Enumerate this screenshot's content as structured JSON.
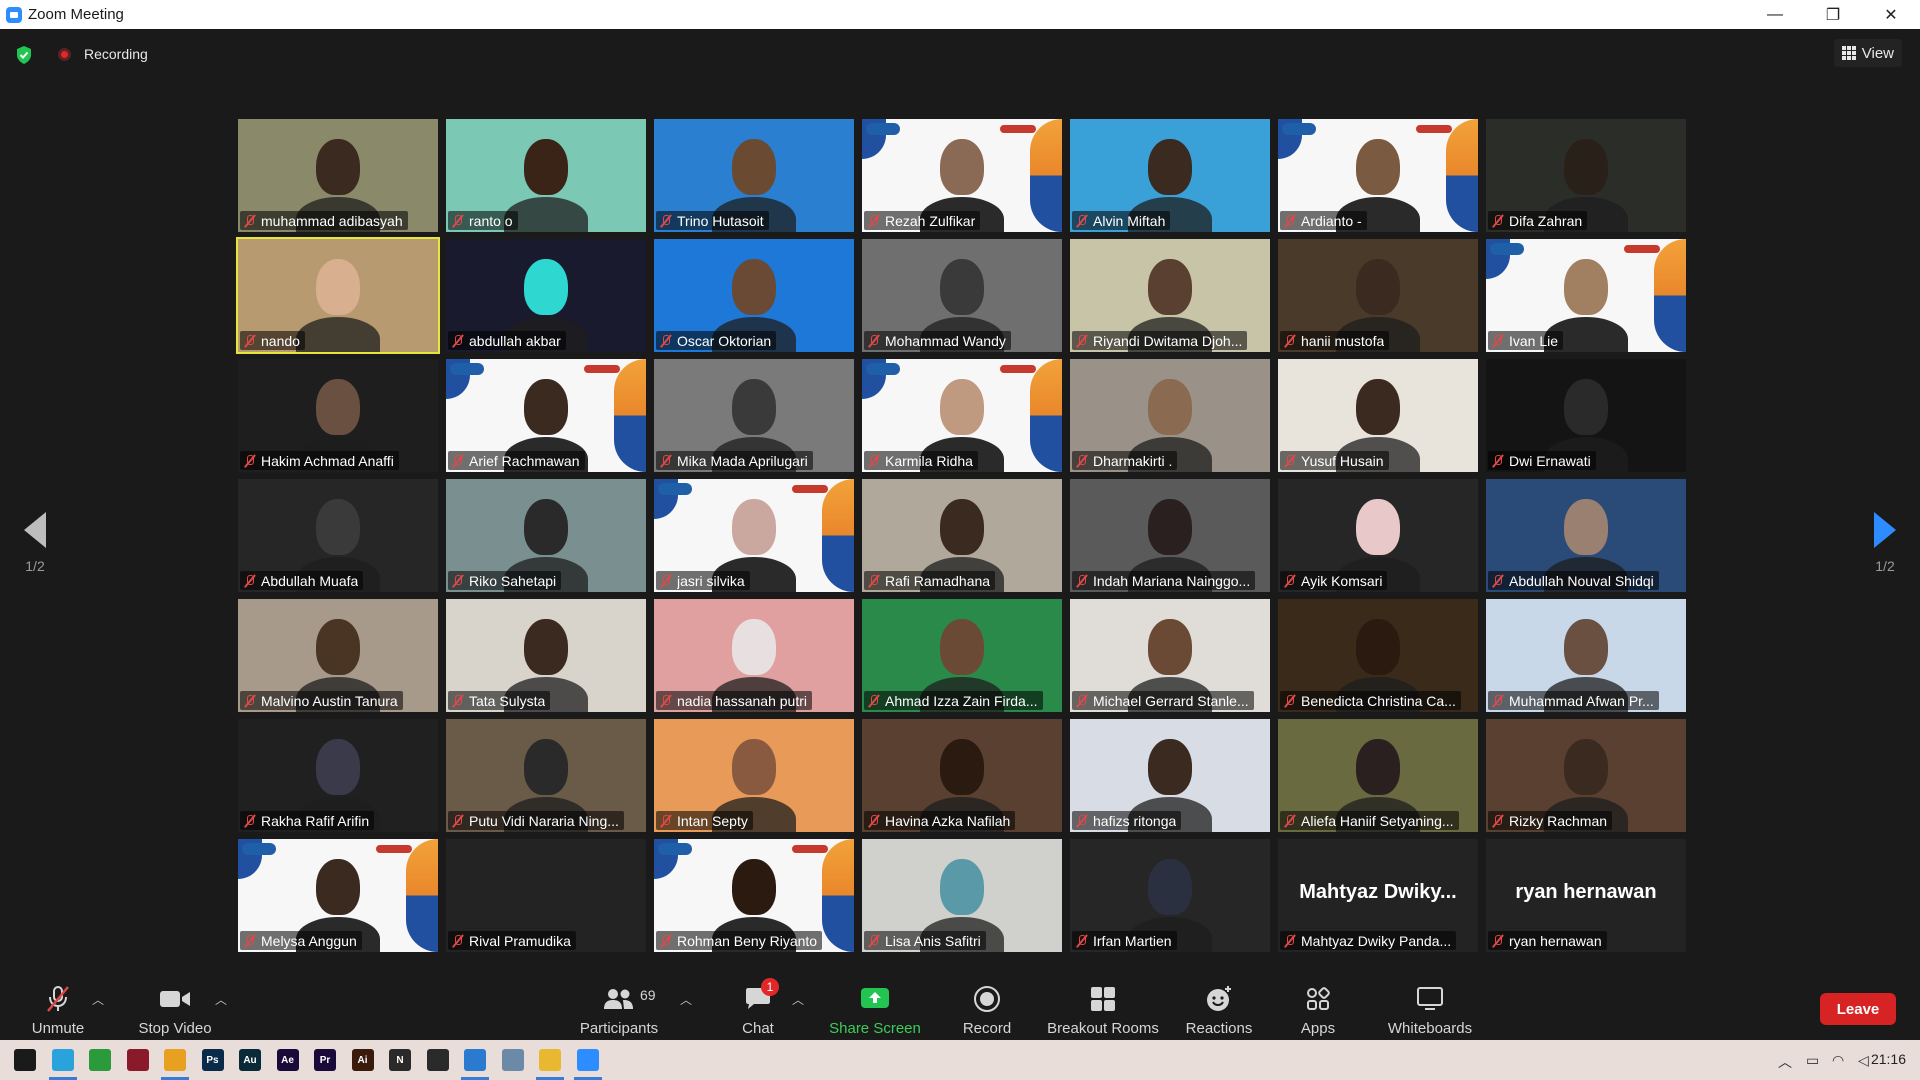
{
  "window": {
    "title": "Zoom Meeting",
    "controls": [
      "—",
      "❐",
      "✕"
    ]
  },
  "meeting_top": {
    "recording_label": "Recording",
    "view_label": "View"
  },
  "pagination": {
    "left_page": "1/2",
    "right_page": "1/2"
  },
  "participants": [
    {
      "name": "muhammad adibasyah",
      "bg": "#8a8a6a",
      "skin": "#3a2a20"
    },
    {
      "name": "ranto o",
      "bg": "#7bc8b5",
      "skin": "#3a2418"
    },
    {
      "name": "Trino Hutasoit",
      "bg": "#2a7fd0",
      "skin": "#6a4a30"
    },
    {
      "name": "Rezah Zulfikar",
      "bg": "banner",
      "skin": "#8a6a55"
    },
    {
      "name": "Alvin Miftah",
      "bg": "#3aa0d8",
      "skin": "#3a2a20"
    },
    {
      "name": "Ardianto -",
      "bg": "banner",
      "skin": "#7a5a40"
    },
    {
      "name": "Difa Zahran",
      "bg": "#2a2d28",
      "skin": "#2a201a"
    },
    {
      "name": "nando",
      "bg": "#b89a70",
      "skin": "#d8b090",
      "active": true
    },
    {
      "name": "abdullah akbar",
      "bg": "#1a1a2e",
      "skin": "#2ed8d0"
    },
    {
      "name": "Oscar Oktorian",
      "bg": "#1e78d8",
      "skin": "#6a4a35"
    },
    {
      "name": "Mohammad Wandy",
      "bg": "#6f6f6f",
      "skin": "#3a3a3a"
    },
    {
      "name": "Riyandi Dwitama Djoh...",
      "bg": "#c8c4a8",
      "skin": "#5a4030"
    },
    {
      "name": "hanii mustofa",
      "bg": "#4a3a2a",
      "skin": "#3a2a20"
    },
    {
      "name": "Ivan Lie",
      "bg": "banner",
      "skin": "#a08060"
    },
    {
      "name": "Hakim Achmad Anaffi",
      "bg": "#1e1e1e",
      "skin": "#6a5040"
    },
    {
      "name": "Arief Rachmawan",
      "bg": "banner",
      "skin": "#3a2a20"
    },
    {
      "name": "Mika Mada Aprilugari",
      "bg": "#7a7a7a",
      "skin": "#3a3a3a"
    },
    {
      "name": "Karmila Ridha",
      "bg": "banner",
      "skin": "#c09a80"
    },
    {
      "name": "Dharmakirti .",
      "bg": "#9a9288",
      "skin": "#8a6a50"
    },
    {
      "name": "Yusuf Husain",
      "bg": "#e8e4dc",
      "skin": "#3a2a20"
    },
    {
      "name": "Dwi Ernawati",
      "bg": "#141414",
      "skin": "#2a2a2a"
    },
    {
      "name": "Abdullah Muafa",
      "bg": "#262626",
      "skin": "#3a3a3a"
    },
    {
      "name": "Riko Sahetapi",
      "bg": "#7a9090",
      "skin": "#2a2a2a"
    },
    {
      "name": "jasri silvika",
      "bg": "banner",
      "skin": "#caa8a0"
    },
    {
      "name": "Rafi Ramadhana",
      "bg": "#b0a89a",
      "skin": "#3a2a20"
    },
    {
      "name": "Indah Mariana Nainggo...",
      "bg": "#5a5a5a",
      "skin": "#2a2020"
    },
    {
      "name": "Ayik Komsari",
      "bg": "#262626",
      "skin": "#e8c8c8"
    },
    {
      "name": "Abdullah Nouval Shidqi",
      "bg": "#2a4a78",
      "skin": "#9a8070"
    },
    {
      "name": "Malvino Austin Tanura",
      "bg": "#a89a8a",
      "skin": "#4a3424"
    },
    {
      "name": "Tata Sulysta",
      "bg": "#d8d4cc",
      "skin": "#3a2a20"
    },
    {
      "name": "nadia hassanah putri",
      "bg": "#e0a0a0",
      "skin": "#e8e0e0"
    },
    {
      "name": "Ahmad Izza Zain Firda...",
      "bg": "#2a8a4a",
      "skin": "#6a4a35"
    },
    {
      "name": "Michael Gerrard Stanle...",
      "bg": "#e0ddd8",
      "skin": "#6a4a35"
    },
    {
      "name": "Benedicta Christina Ca...",
      "bg": "#3a2a1a",
      "skin": "#2a1a10"
    },
    {
      "name": "Muhammad Afwan Pr...",
      "bg": "#c8d8e8",
      "skin": "#6a5040"
    },
    {
      "name": "Rakha Rafif Arifin",
      "bg": "#202020",
      "skin": "#3a3a4a"
    },
    {
      "name": "Putu Vidi Nararia Ning...",
      "bg": "#6a5a48",
      "skin": "#2a2a2a"
    },
    {
      "name": "Intan Septy",
      "bg": "#e89a58",
      "skin": "#8a5a40"
    },
    {
      "name": "Havina Azka Nafilah",
      "bg": "#5a4030",
      "skin": "#2a1a10"
    },
    {
      "name": "hafizs ritonga",
      "bg": "#d8dce4",
      "skin": "#3a2a20"
    },
    {
      "name": "Aliefa Haniif Setyaning...",
      "bg": "#6a6a40",
      "skin": "#2a2020"
    },
    {
      "name": "Rizky Rachman",
      "bg": "#5a4030",
      "skin": "#3a2a20"
    },
    {
      "name": "Melysa Anggun",
      "bg": "banner",
      "skin": "#3a2a20"
    },
    {
      "name": "Rival Pramudika",
      "bg": "#232323",
      "skin": "none"
    },
    {
      "name": "Rohman Beny Riyanto",
      "bg": "banner",
      "skin": "#2a1a10"
    },
    {
      "name": "Lisa Anis Safitri",
      "bg": "#d0d0cc",
      "skin": "#5a9aa8"
    },
    {
      "name": "Irfan Martien",
      "bg": "#262626",
      "skin": "#2a3040"
    },
    {
      "name": "Mahtyaz Dwiky Panda...",
      "bg": "#232323",
      "skin": "none",
      "big_name": "Mahtyaz  Dwiky..."
    },
    {
      "name": "ryan hernawan",
      "bg": "#232323",
      "skin": "none",
      "big_name": "ryan hernawan"
    }
  ],
  "toolbar": {
    "unmute": "Unmute",
    "stop_video": "Stop Video",
    "participants": "Participants",
    "participants_count": "69",
    "chat": "Chat",
    "chat_badge": "1",
    "share_screen": "Share Screen",
    "record": "Record",
    "breakout_rooms": "Breakout Rooms",
    "reactions": "Reactions",
    "apps": "Apps",
    "whiteboards": "Whiteboards",
    "leave": "Leave"
  },
  "taskbar": {
    "apps": [
      {
        "name": "windows-start",
        "label": "",
        "color": "#1a1a1a"
      },
      {
        "name": "telegram",
        "label": "",
        "color": "#2aa3dd"
      },
      {
        "name": "camtasia",
        "label": "",
        "color": "#2a9a3a"
      },
      {
        "name": "mcafee",
        "label": "",
        "color": "#8a1a2a"
      },
      {
        "name": "chrome",
        "label": "",
        "color": "#e8a020"
      },
      {
        "name": "photoshop",
        "label": "Ps",
        "color": "#0a2a4a"
      },
      {
        "name": "audition",
        "label": "Au",
        "color": "#0a2a3a"
      },
      {
        "name": "after-effects",
        "label": "Ae",
        "color": "#1a0a3a"
      },
      {
        "name": "premiere",
        "label": "Pr",
        "color": "#1a0a3a"
      },
      {
        "name": "illustrator",
        "label": "Ai",
        "color": "#3a1a0a"
      },
      {
        "name": "notion",
        "label": "N",
        "color": "#2a2a2a"
      },
      {
        "name": "github",
        "label": "",
        "color": "#2a2a2a"
      },
      {
        "name": "vscode",
        "label": "",
        "color": "#2a7ad0"
      },
      {
        "name": "photos",
        "label": "",
        "color": "#6a8aa8"
      },
      {
        "name": "file-explorer",
        "label": "",
        "color": "#e8b830"
      },
      {
        "name": "zoom",
        "label": "",
        "color": "#2d8cff"
      }
    ],
    "time": "21:16"
  }
}
